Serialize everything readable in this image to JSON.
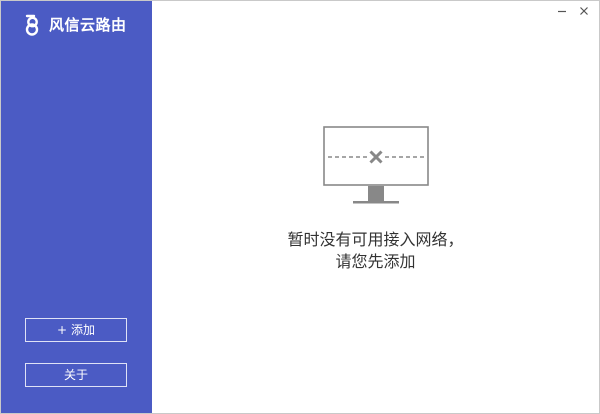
{
  "app": {
    "title": "风信云路由"
  },
  "sidebar": {
    "add_plus": "+",
    "add_label": "添加",
    "about_label": "关于"
  },
  "empty_state": {
    "line1": "暂时没有可用接入网络，",
    "line2": "请您先添加"
  },
  "icons": {
    "logo": "brand-logo-icon",
    "minimize": "minimize-icon",
    "close": "close-icon",
    "monitor": "monitor-disconnected-icon"
  },
  "colors": {
    "sidebar_bg": "#4b5bc4",
    "text_main": "#333333",
    "icon_gray": "#888888"
  }
}
